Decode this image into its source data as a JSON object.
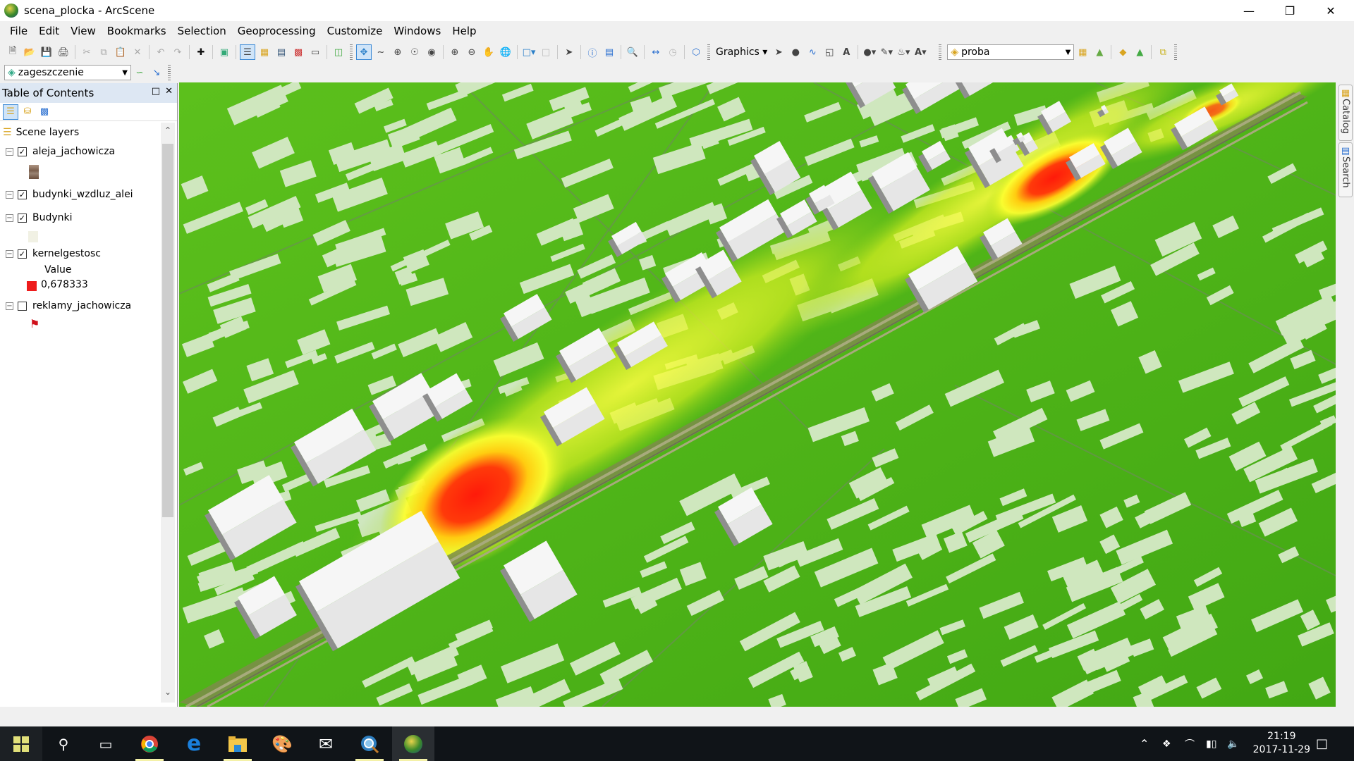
{
  "window": {
    "title": "scena_plocka - ArcScene",
    "controls": [
      "minimize",
      "restore",
      "close"
    ]
  },
  "menu": [
    "File",
    "Edit",
    "View",
    "Bookmarks",
    "Selection",
    "Geoprocessing",
    "Customize",
    "Windows",
    "Help"
  ],
  "toolbar": {
    "graphics_label": "Graphics",
    "layer_combo_value": "proba",
    "secondary_combo_value": "zageszczenie"
  },
  "toc": {
    "title": "Table of Contents",
    "root": "Scene layers",
    "layers": [
      {
        "name": "aleja_jachowicza",
        "checked": true,
        "swatch": "#8a6c58"
      },
      {
        "name": "budynki_wzdluz_alei",
        "checked": true,
        "swatch": ""
      },
      {
        "name": "Budynki",
        "checked": true,
        "swatch": "#f1f1e4"
      },
      {
        "name": "kernelgestosc",
        "checked": true,
        "legend_heading": "Value",
        "legend_value": "0,678333",
        "swatch": "#ee1c1c"
      },
      {
        "name": "reklamy_jachowicza",
        "checked": false,
        "swatch": "#d0101a"
      }
    ]
  },
  "side_tabs": [
    "Catalog",
    "Search"
  ],
  "scene": {
    "ground_color": "#4fb51a",
    "footprint_color": "#cfe7be",
    "building_color": "#f4f4f4",
    "heat_colors": [
      "#ff1a0a",
      "#ffff20",
      "#b6e21e"
    ]
  },
  "taskbar": {
    "apps": [
      "start",
      "search",
      "task-view",
      "chrome",
      "edge",
      "file-explorer",
      "paint",
      "mail",
      "arcgis-search",
      "arcscene"
    ],
    "time": "21:19",
    "date": "2017-11-29"
  }
}
